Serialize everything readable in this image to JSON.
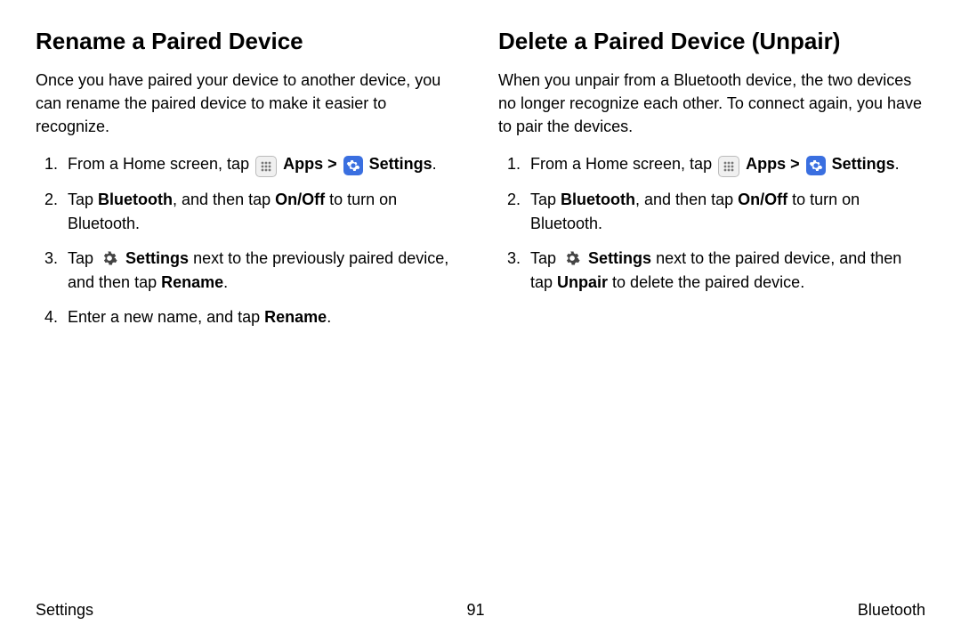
{
  "left": {
    "heading": "Rename a Paired Device",
    "intro": "Once you have paired your device to another device, you can rename the paired device to make it easier to recognize.",
    "step1_a": "From a Home screen, tap ",
    "step1_apps": "Apps",
    "step1_sep": " > ",
    "step1_settings": "Settings",
    "step1_end": ".",
    "step2_a": "Tap ",
    "step2_b": "Bluetooth",
    "step2_c": ", and then tap ",
    "step2_d": "On/Off",
    "step2_e": " to turn on Bluetooth.",
    "step3_a": "Tap ",
    "step3_b": "Settings",
    "step3_c": " next to the previously paired device, and then tap ",
    "step3_d": "Rename",
    "step3_e": ".",
    "step4_a": "Enter a new name, and tap ",
    "step4_b": "Rename",
    "step4_c": "."
  },
  "right": {
    "heading": "Delete a Paired Device (Unpair)",
    "intro": "When you unpair from a Bluetooth device, the two devices no longer recognize each other. To connect again, you have to pair the devices.",
    "step1_a": "From a Home screen, tap ",
    "step1_apps": "Apps",
    "step1_sep": " > ",
    "step1_settings": "Settings",
    "step1_end": ".",
    "step2_a": "Tap ",
    "step2_b": "Bluetooth",
    "step2_c": ", and then tap ",
    "step2_d": "On/Off",
    "step2_e": " to turn on Bluetooth.",
    "step3_a": "Tap ",
    "step3_b": "Settings",
    "step3_c": " next to the paired device, and then tap ",
    "step3_d": "Unpair",
    "step3_e": " to delete the paired device."
  },
  "footer": {
    "left": "Settings",
    "center": "91",
    "right": "Bluetooth"
  }
}
